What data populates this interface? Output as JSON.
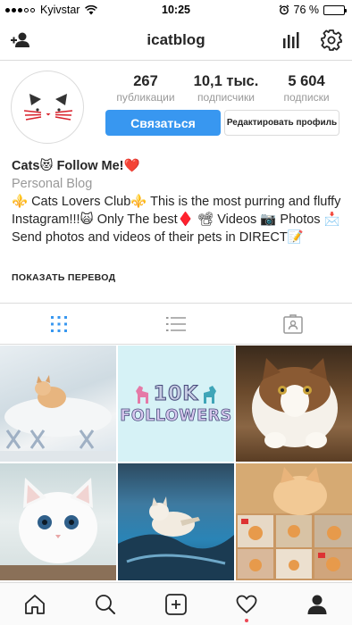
{
  "status_bar": {
    "carrier": "Kyivstar",
    "time": "10:25",
    "battery": "76 %",
    "battery_level": 0.76
  },
  "header": {
    "title": "icatblog"
  },
  "profile": {
    "stats": [
      {
        "value": "267",
        "label": "публикации"
      },
      {
        "value": "10,1 тыс.",
        "label": "подписчики"
      },
      {
        "value": "5 604",
        "label": "подписки"
      }
    ],
    "contact_button": "Связаться",
    "edit_button": "Редактировать профиль"
  },
  "bio": {
    "name": "Cats😻 Follow Me!❤️",
    "category": "Personal Blog",
    "text": "⚜️ Cats Lovers Club⚜️  This is the most purring and fluffy Instagram!!!🙀  Only The best♦️  📽 Videos 📷 Photos 📩 Send photos and videos of their pets in DIRECT📝",
    "translate_link": "ПОКАЗАТЬ ПЕРЕВОД"
  },
  "tabs": [
    {
      "name": "grid",
      "icon": "grid-icon",
      "active": true
    },
    {
      "name": "list",
      "icon": "list-icon",
      "active": false
    },
    {
      "name": "tagged",
      "icon": "tagged-icon",
      "active": false
    }
  ],
  "grid_posts": {
    "post2_line1": "10K",
    "post2_line2": "FOLLOWERS"
  },
  "bottom_nav": [
    {
      "name": "home",
      "icon": "home-icon"
    },
    {
      "name": "search",
      "icon": "search-icon"
    },
    {
      "name": "new-post",
      "icon": "plus-square-icon"
    },
    {
      "name": "activity",
      "icon": "heart-icon"
    },
    {
      "name": "profile",
      "icon": "profile-icon"
    }
  ],
  "colors": {
    "accent": "#3897f0",
    "grid_tab_active": "#3897f0",
    "notification": "#ed4956"
  }
}
